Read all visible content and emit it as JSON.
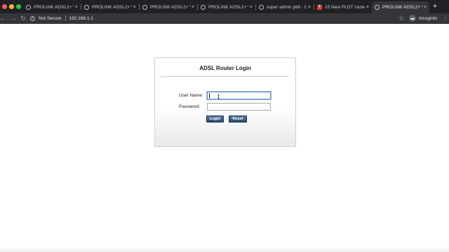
{
  "browser": {
    "tabs": [
      {
        "title": "PROLINK ADSL2+ W",
        "icon": "globe-icon",
        "active": false
      },
      {
        "title": "PROLINK ADSL2+ W",
        "icon": "globe-icon",
        "active": false
      },
      {
        "title": "PROLINK ADSL2+ W",
        "icon": "globe-icon",
        "active": false
      },
      {
        "title": "PROLINK ADSL2+ W",
        "icon": "globe-icon",
        "active": false
      },
      {
        "title": "super admin pldt - G",
        "icon": "google-icon",
        "active": false
      },
      {
        "title": "15 New PLDT router",
        "icon": "t-site-icon",
        "active": false
      },
      {
        "title": "PROLINK ADSL2+ W",
        "icon": "globe-icon",
        "active": true
      }
    ],
    "tab_close_glyph": "×",
    "new_tab_glyph": "+",
    "security_label": "Not Secure",
    "url": "192.168.1.1",
    "profile_label": "Incognito",
    "colors": {
      "tabstrip": "#202124",
      "toolbar": "#35363a"
    }
  },
  "login": {
    "title": "ADSL Router Login",
    "username_label": "User Name:",
    "password_label": "Password:",
    "username_value": "",
    "password_value": "",
    "login_button": "Login",
    "reset_button": "Reset",
    "colors": {
      "button": "#2f4f77",
      "panel_border": "#cfcfcf"
    }
  }
}
